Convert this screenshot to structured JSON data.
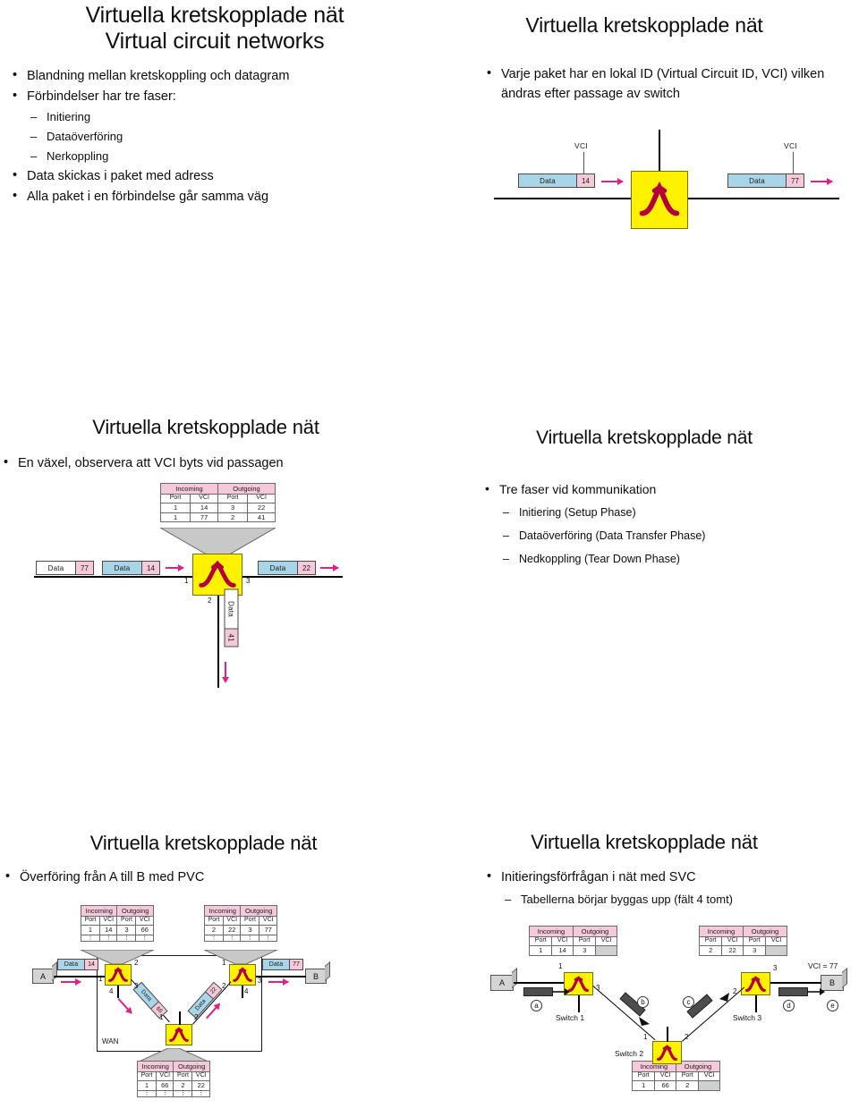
{
  "deck": {
    "slide_title": "Virtuella kretskopplade nät",
    "slides": [
      {
        "id": "s1",
        "title_line1": "Virtuella kretskopplade nät",
        "title_line2": "Virtual circuit networks",
        "bullets": [
          {
            "level": 1,
            "text": "Blandning mellan kretskoppling och datagram"
          },
          {
            "level": 1,
            "text": "Förbindelser har tre faser:"
          },
          {
            "level": 2,
            "text": "Initiering"
          },
          {
            "level": 2,
            "text": "Dataöverföring"
          },
          {
            "level": 2,
            "text": "Nerkoppling"
          },
          {
            "level": 1,
            "text": "Data skickas i paket med adress"
          },
          {
            "level": 1,
            "text": "Alla paket i en förbindelse går samma väg"
          }
        ]
      },
      {
        "id": "s2",
        "title_line1": "Virtuella kretskopplade nät",
        "bullets": [
          {
            "level": 1,
            "text": "Varje paket har en lokal ID (Virtual Circuit ID, VCI) vilken ändras efter passage av switch"
          }
        ],
        "diagram": {
          "type": "single-switch-vci-change",
          "vci_label_left": "VCI",
          "vci_label_right": "VCI",
          "packet_in": {
            "data_label": "Data",
            "vci": "14"
          },
          "packet_out": {
            "data_label": "Data",
            "vci": "77"
          }
        }
      },
      {
        "id": "s3",
        "title_line1": "Virtuella kretskopplade nät",
        "bullets": [
          {
            "level": 1,
            "text": "En växel, observera att VCI byts vid passagen"
          }
        ],
        "diagram": {
          "type": "switch-with-table",
          "table": {
            "groups": [
              "Incoming",
              "Outgoing"
            ],
            "columns": [
              "Port",
              "VCI",
              "Port",
              "VCI"
            ],
            "rows": [
              [
                "1",
                "14",
                "3",
                "22"
              ],
              [
                "1",
                "77",
                "2",
                "41"
              ]
            ]
          },
          "packets_in": [
            {
              "data_label": "Data",
              "vci": "77",
              "style": "white"
            },
            {
              "data_label": "Data",
              "vci": "14",
              "style": "blue"
            }
          ],
          "packet_out_right": {
            "data_label": "Data",
            "vci": "22"
          },
          "packet_out_down": {
            "data_label": "Data",
            "vci": "41"
          },
          "ports": [
            "1",
            "3",
            "2"
          ]
        }
      },
      {
        "id": "s4",
        "title_line1": "Virtuella kretskopplade nät",
        "bullets": [
          {
            "level": 1,
            "text": "Tre faser vid kommunikation"
          },
          {
            "level": 2,
            "text": "Initiering (Setup Phase)"
          },
          {
            "level": 2,
            "text": "Dataöverföring (Data Transfer Phase)"
          },
          {
            "level": 2,
            "text": "Nedkoppling (Tear Down Phase)"
          }
        ]
      },
      {
        "id": "s5",
        "title_line1": "Virtuella kretskopplade nät",
        "bullets": [
          {
            "level": 1,
            "text": "Överföring från A till B med PVC"
          }
        ],
        "diagram": {
          "type": "pvc-wan",
          "wan_label": "WAN",
          "endpoints": {
            "left": "A",
            "right": "B"
          },
          "tables": [
            {
              "name": "switch1-table",
              "groups": [
                "Incoming",
                "Outgoing"
              ],
              "columns": [
                "Port",
                "VCI",
                "Port",
                "VCI"
              ],
              "rows": [
                [
                  "1",
                  "14",
                  "3",
                  "66"
                ],
                [
                  "⋮",
                  "⋮",
                  "⋮",
                  "⋮"
                ]
              ]
            },
            {
              "name": "switch3-table",
              "groups": [
                "Incoming",
                "Outgoing"
              ],
              "columns": [
                "Port",
                "VCI",
                "Port",
                "VCI"
              ],
              "rows": [
                [
                  "2",
                  "22",
                  "3",
                  "77"
                ],
                [
                  "⋮",
                  "⋮",
                  "⋮",
                  "⋮"
                ]
              ]
            },
            {
              "name": "switch2-table",
              "groups": [
                "Incoming",
                "Outgoing"
              ],
              "columns": [
                "Port",
                "VCI",
                "Port",
                "VCI"
              ],
              "rows": [
                [
                  "1",
                  "66",
                  "2",
                  "22"
                ],
                [
                  "⋮",
                  "⋮",
                  "⋮",
                  "⋮"
                ]
              ]
            }
          ],
          "packets": [
            {
              "data_label": "Data",
              "vci": "14"
            },
            {
              "data_label": "Data",
              "vci": "66"
            },
            {
              "data_label": "Data",
              "vci": "22"
            },
            {
              "data_label": "Data",
              "vci": "77"
            }
          ],
          "port_numbers": [
            "1",
            "2",
            "3",
            "4",
            "1",
            "2",
            "1",
            "2",
            "3",
            "4"
          ]
        }
      },
      {
        "id": "s6",
        "title_line1": "Virtuella kretskopplade nät",
        "bullets": [
          {
            "level": 1,
            "text": "Initieringsförfrågan i nät med SVC"
          },
          {
            "level": 2,
            "text": "Tabellerna börjar byggas upp (fält 4 tomt)"
          }
        ],
        "diagram": {
          "type": "svc-setup",
          "endpoints": {
            "left": "A",
            "right": "B"
          },
          "right_annotation": "VCI = 77",
          "switch_labels": [
            "Switch 1",
            "Switch 2",
            "Switch 3"
          ],
          "step_markers": [
            "a",
            "b",
            "c",
            "d",
            "e"
          ],
          "tables": [
            {
              "name": "switch1-table",
              "groups": [
                "Incoming",
                "Outgoing"
              ],
              "columns": [
                "Port",
                "VCI",
                "Port",
                "VCI"
              ],
              "rows": [
                [
                  "1",
                  "14",
                  "3",
                  ""
                ]
              ]
            },
            {
              "name": "switch3-table",
              "groups": [
                "Incoming",
                "Outgoing"
              ],
              "columns": [
                "Port",
                "VCI",
                "Port",
                "VCI"
              ],
              "rows": [
                [
                  "2",
                  "22",
                  "3",
                  ""
                ]
              ]
            },
            {
              "name": "switch2-table",
              "groups": [
                "Incoming",
                "Outgoing"
              ],
              "columns": [
                "Port",
                "VCI",
                "Port",
                "VCI"
              ],
              "rows": [
                [
                  "1",
                  "66",
                  "2",
                  ""
                ]
              ]
            }
          ],
          "port_numbers": [
            "1",
            "3",
            "1",
            "2",
            "2",
            "3"
          ]
        }
      }
    ]
  },
  "colors": {
    "switch_fill": "#FFF200",
    "switch_glyph": "#B3003C",
    "packet_data": "#A9D5E8",
    "packet_vci": "#F6C9DA",
    "table_header": "#F6C9DA",
    "arrow": "#E0218A",
    "empty_cell": "#cfcfcf",
    "node_fill": "#D4D4D4"
  }
}
